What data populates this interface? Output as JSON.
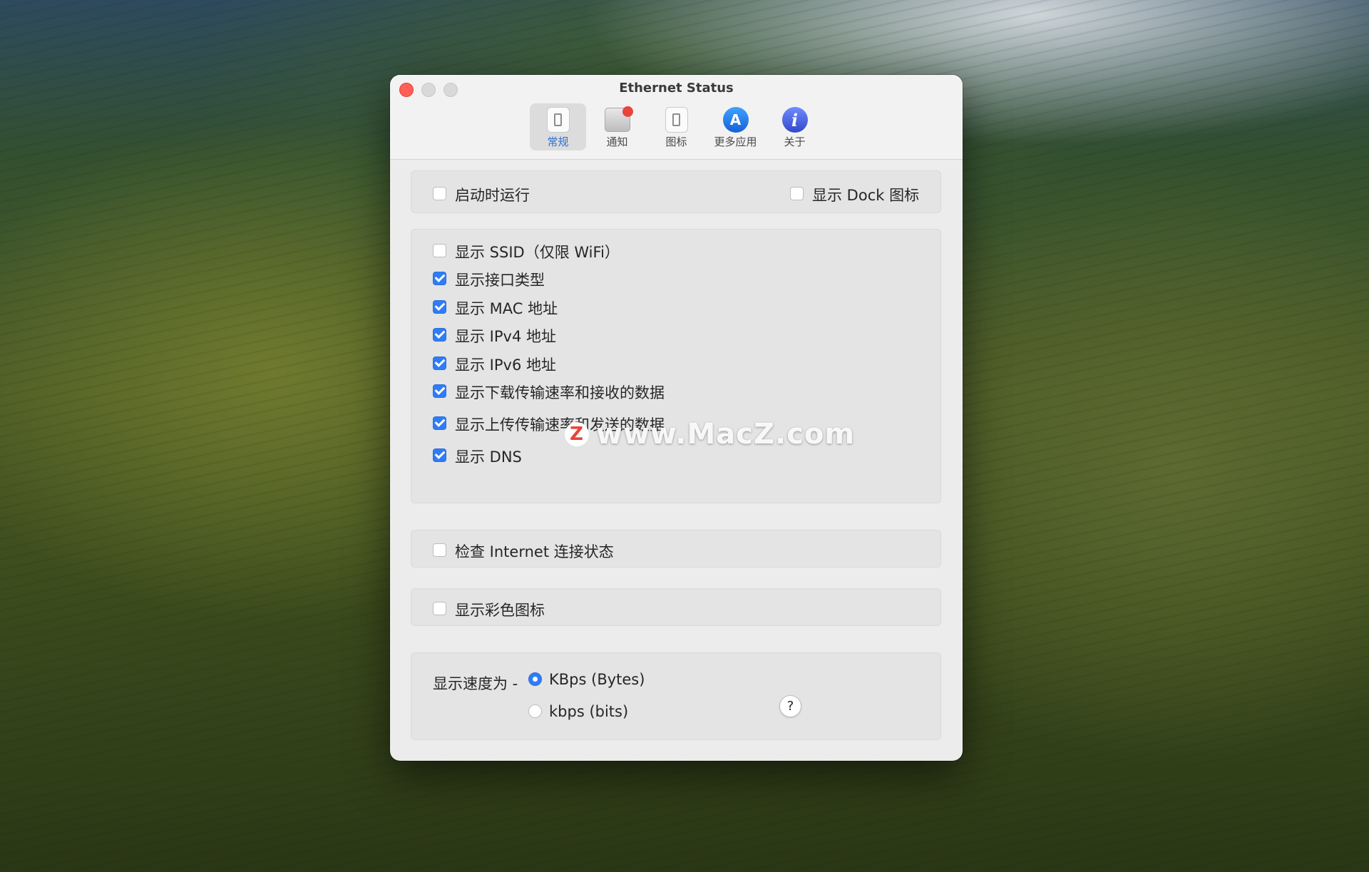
{
  "window": {
    "title": "Ethernet Status"
  },
  "toolbar": {
    "tabs": [
      {
        "label": "常规",
        "icon": "switch-icon",
        "active": true
      },
      {
        "label": "通知",
        "icon": "notification-icon",
        "active": false
      },
      {
        "label": "图标",
        "icon": "switch-icon",
        "active": false
      },
      {
        "label": "更多应用",
        "icon": "app-store-icon",
        "active": false
      },
      {
        "label": "关于",
        "icon": "info-icon",
        "active": false
      }
    ],
    "appstore_glyph": "A",
    "info_glyph": "i"
  },
  "general": {
    "launch_at_login": {
      "label": "启动时运行",
      "checked": false
    },
    "show_dock_icon": {
      "label": "显示 Dock 图标",
      "checked": false
    }
  },
  "display_options": [
    {
      "label": "显示 SSID（仅限 WiFi）",
      "checked": false
    },
    {
      "label": "显示接口类型",
      "checked": true
    },
    {
      "label": "显示 MAC 地址",
      "checked": true
    },
    {
      "label": "显示 IPv4 地址",
      "checked": true
    },
    {
      "label": "显示 IPv6 地址",
      "checked": true
    },
    {
      "label": "显示下载传输速率和接收的数据",
      "checked": true
    },
    {
      "label": "显示上传传输速率和发送的数据",
      "checked": true
    },
    {
      "label": "显示 DNS",
      "checked": true
    }
  ],
  "internet_check": {
    "label": "检查 Internet 连接状态",
    "checked": false
  },
  "color_icon": {
    "label": "显示彩色图标",
    "checked": false
  },
  "speed_unit": {
    "label": "显示速度为 -",
    "options": [
      {
        "label": "KBps (Bytes)",
        "selected": true
      },
      {
        "label": "kbps (bits)",
        "selected": false
      }
    ],
    "help": "?"
  },
  "watermark": {
    "logo": "Z",
    "text": "www.MacZ.com"
  },
  "colors": {
    "accent": "#2f7cf6",
    "close": "#ff5f57",
    "badge": "#e8453c"
  }
}
